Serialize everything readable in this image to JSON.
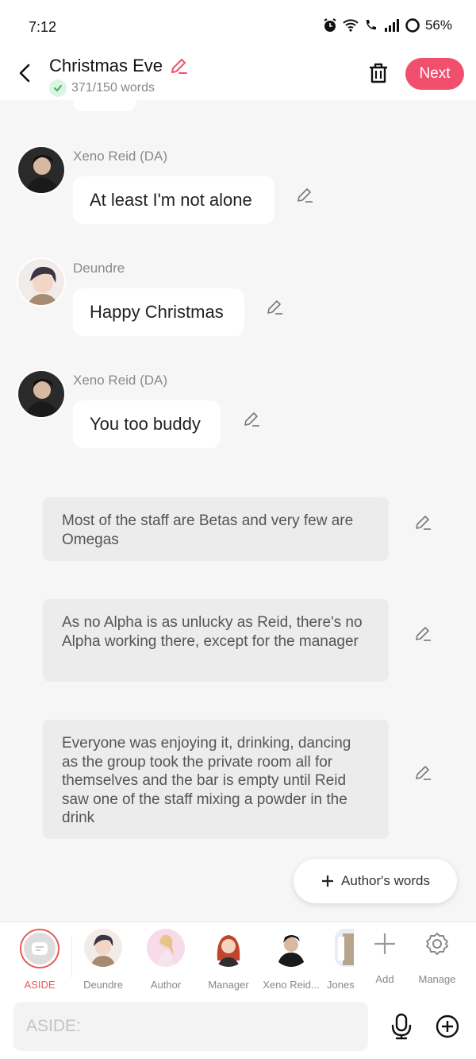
{
  "status": {
    "time": "7:12",
    "battery": "56%"
  },
  "header": {
    "title": "Christmas Eve",
    "word_count": "371/150 words",
    "next_label": "Next"
  },
  "messages": [
    {
      "speaker": "Xeno Reid (DA)",
      "text": "At least I'm not alone"
    },
    {
      "speaker": "Deundre",
      "text": "Happy Christmas"
    },
    {
      "speaker": "Xeno Reid (DA)",
      "text": "You too buddy"
    }
  ],
  "asides": [
    "Most of the staff are Betas and very few are Omegas",
    "As no Alpha is as unlucky as Reid, there's no Alpha working there, except for the manager",
    "Everyone was enjoying it, drinking, dancing as the group took the private room all for themselves and the bar is empty until Reid saw one of the staff mixing a powder in the drink"
  ],
  "authors_words_label": "Author's words",
  "characters": [
    {
      "label": "ASIDE",
      "icon": "aside-icon"
    },
    {
      "label": "Deundre",
      "icon": "avatar"
    },
    {
      "label": "Author",
      "icon": "avatar"
    },
    {
      "label": "Manager",
      "icon": "avatar"
    },
    {
      "label": "Xeno Reid...",
      "icon": "avatar"
    },
    {
      "label": "Jones",
      "icon": "avatar"
    }
  ],
  "actions": {
    "add_label": "Add",
    "manage_label": "Manage"
  },
  "input": {
    "placeholder": "ASIDE:"
  },
  "colors": {
    "accent": "#f0506e",
    "aside_ring": "#e85a5a",
    "check_green": "#3cb060"
  }
}
